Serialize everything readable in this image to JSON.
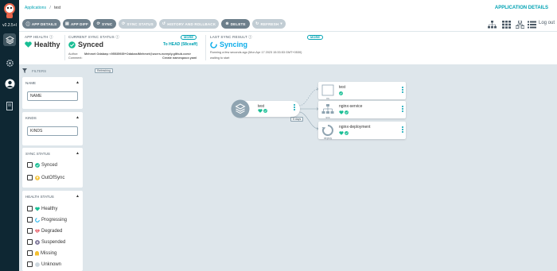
{
  "app": {
    "version": "v2.2.5+l"
  },
  "breadcrumb": {
    "root": "Applications",
    "sep": "/",
    "current": "test"
  },
  "page_title": "APPLICATION DETAILS",
  "toolbar": {
    "app_details": "APP DETAILS",
    "app_diff": "APP DIFF",
    "sync": "SYNC",
    "sync_status": "SYNC STATUS",
    "history": "HISTORY AND ROLLBACK",
    "delete": "DELETE",
    "refresh": "REFRESH",
    "logout": "Log out"
  },
  "status": {
    "health_label": "APP HEALTH",
    "health_value": "Healthy",
    "sync_label": "CURRENT SYNC STATUS",
    "sync_value": "Synced",
    "more": "MORE",
    "to_head": "To HEAD (58ceaff)",
    "author_label": "Author:",
    "author_value": "Mehmet Odabaşı <95535935+OdabasiMehmet@users.noreply.github.com>",
    "comment_label": "Comment:",
    "comment_value": "Create namespace.yaml",
    "last_sync_label": "LAST SYNC RESULT",
    "last_sync_value": "Syncing",
    "running": "Running a few seconds ago (Mon Apr 17 2023 15:33:53 GMT+0530)",
    "waiting": "waiting to start"
  },
  "canvas": {
    "refreshing": "Refreshing",
    "edge_label": "5 days",
    "nodes": {
      "root": {
        "title": "test"
      },
      "ns": {
        "title": "test",
        "kind": "ns"
      },
      "svc": {
        "title": "nginx-service",
        "kind": "svc"
      },
      "deploy": {
        "title": "nginx-deployment",
        "kind": "deploy"
      }
    }
  },
  "filters": {
    "header": "FILTERS",
    "name": {
      "title": "NAME",
      "placeholder": "NAME"
    },
    "kinds": {
      "title": "KINDS",
      "placeholder": "KINDS"
    },
    "sync_status": {
      "title": "SYNC STATUS",
      "items": [
        "Synced",
        "OutOfSync"
      ]
    },
    "health_status": {
      "title": "HEALTH STATUS",
      "items": [
        "Healthy",
        "Progressing",
        "Degraded",
        "Suspended",
        "Missing",
        "Unknown"
      ]
    }
  },
  "colors": {
    "accent": "#00a2b3",
    "healthy": "#18be94",
    "synced": "#18be94",
    "degraded": "#e96d76",
    "suspended": "#766f94",
    "missing": "#f4c030",
    "unknown": "#ccd6dd",
    "sidebar": "#0e2733",
    "button": "#6d7f8b"
  }
}
